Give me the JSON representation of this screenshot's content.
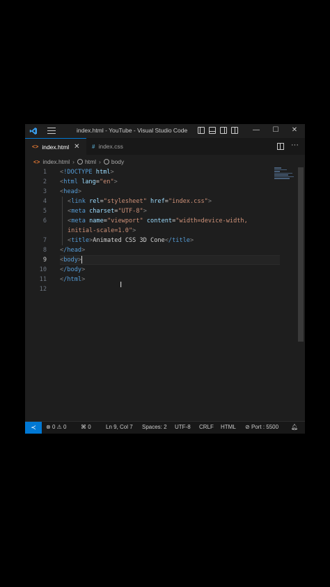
{
  "window": {
    "title": "index.html - YouTube - Visual Studio Code",
    "controls": {
      "minimize": "—",
      "maximize": "☐",
      "close": "✕"
    }
  },
  "tabs": [
    {
      "label": "index.html",
      "icon": "<>",
      "icon_name": "html-file-icon",
      "active": true,
      "close": "✕"
    },
    {
      "label": "index.css",
      "icon": "#",
      "icon_name": "css-file-icon",
      "active": false
    }
  ],
  "tabbar_actions": {
    "more": "···"
  },
  "breadcrumb": {
    "file": "index.html",
    "items": [
      "html",
      "body"
    ],
    "separator": "›"
  },
  "editor": {
    "current_line": 9,
    "lines": [
      {
        "n": "1"
      },
      {
        "n": "2"
      },
      {
        "n": "3"
      },
      {
        "n": "4"
      },
      {
        "n": "5"
      },
      {
        "n": "6"
      },
      {
        "n": ""
      },
      {
        "n": "7"
      },
      {
        "n": "8"
      },
      {
        "n": "9"
      },
      {
        "n": "10"
      },
      {
        "n": "11"
      },
      {
        "n": "12"
      }
    ],
    "tokens": {
      "l1_open": "<",
      "l1_doctype": "!DOCTYPE",
      "l1_html": " html",
      "l1_close": ">",
      "l2_tag": "html",
      "l2_attr": " lang",
      "l2_val": "\"en\"",
      "l3_tag": "head",
      "l4_tag": "link",
      "l4_attr1": " rel",
      "l4_val1": "\"stylesheet\"",
      "l4_attr2": " href",
      "l4_val2": "\"index.css\"",
      "l5_tag": "meta",
      "l5_attr": " charset",
      "l5_val": "\"UTF-8\"",
      "l6_tag": "meta",
      "l6_attr1": " name",
      "l6_val1": "\"viewport\"",
      "l6_attr2": " content",
      "l6_val2a": "\"width=device-width,",
      "l6_val2b": "initial-scale=1.0\"",
      "l7_tag": "title",
      "l7_text": "Animated CSS 3D Cone",
      "l7_close_tag": "/title",
      "l8_tag": "/head",
      "l9_tag": "body",
      "l10_tag": "/body",
      "l11_tag": "/html"
    }
  },
  "statusbar": {
    "remote_icon": "≺",
    "errors": "0",
    "warnings": "0",
    "ports": "0",
    "position": "Ln 9, Col 7",
    "spaces": "Spaces: 2",
    "encoding": "UTF-8",
    "eol": "CRLF",
    "language": "HTML",
    "port": "Port : 5500"
  },
  "colors": {
    "accent": "#0078d4",
    "tag": "#569cd6",
    "attribute": "#9cdcfe",
    "string": "#ce9178"
  }
}
